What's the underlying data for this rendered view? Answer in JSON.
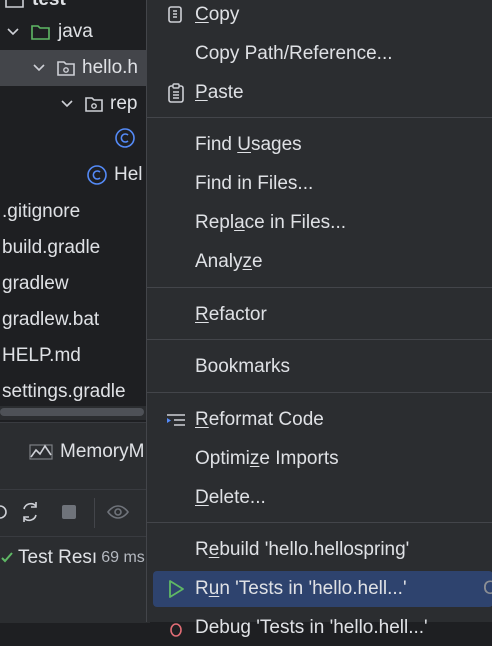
{
  "project_tree": {
    "items": [
      {
        "label": "test",
        "kind": "folder"
      },
      {
        "label": "java",
        "kind": "folder"
      },
      {
        "label": "hello.h",
        "kind": "package"
      },
      {
        "label": "rep",
        "kind": "package"
      },
      {
        "label": "",
        "kind": "class"
      },
      {
        "label": "Hel",
        "kind": "class"
      },
      {
        "label": ".gitignore",
        "kind": "file"
      },
      {
        "label": "build.gradle",
        "kind": "file"
      },
      {
        "label": "gradlew",
        "kind": "file"
      },
      {
        "label": "gradlew.bat",
        "kind": "file"
      },
      {
        "label": "HELP.md",
        "kind": "file"
      },
      {
        "label": "settings.gradle",
        "kind": "file"
      }
    ]
  },
  "bottom_panel": {
    "tab_label": "MemoryM",
    "test_status_label": "Test Resı",
    "test_time": "69 ms"
  },
  "context_menu": {
    "items": [
      {
        "pre": "",
        "u": "C",
        "post": "opy",
        "icon": "copy-icon"
      },
      {
        "pre": "Copy Path/Reference...",
        "u": "",
        "post": "",
        "icon": ""
      },
      {
        "pre": "",
        "u": "P",
        "post": "aste",
        "icon": "paste-icon"
      },
      {
        "pre": "Find ",
        "u": "U",
        "post": "sages",
        "icon": ""
      },
      {
        "pre": "Find in Files...",
        "u": "",
        "post": "",
        "icon": ""
      },
      {
        "pre": "Repl",
        "u": "a",
        "post": "ce in Files...",
        "icon": ""
      },
      {
        "pre": "Analy",
        "u": "z",
        "post": "e",
        "icon": ""
      },
      {
        "pre": "",
        "u": "R",
        "post": "efactor",
        "icon": ""
      },
      {
        "pre": "Bookmarks",
        "u": "",
        "post": "",
        "icon": ""
      },
      {
        "pre": "",
        "u": "R",
        "post": "eformat Code",
        "icon": "reformat-icon"
      },
      {
        "pre": "Optimi",
        "u": "z",
        "post": "e Imports",
        "icon": ""
      },
      {
        "pre": "",
        "u": "D",
        "post": "elete...",
        "icon": ""
      },
      {
        "pre": "R",
        "u": "e",
        "post": "build 'hello.hellospring'",
        "icon": ""
      },
      {
        "pre": "R",
        "u": "u",
        "post": "n 'Tests in 'hello.hell...'",
        "icon": "run-icon",
        "shortcut": "C",
        "highlighted": true
      },
      {
        "pre": "Debug 'Tests in 'hello.hell...'",
        "u": "",
        "post": "",
        "icon": "debug-icon"
      }
    ]
  },
  "colors": {
    "background": "#1e1f22",
    "panel": "#2b2d30",
    "highlight": "#2e436e",
    "text": "#dfe1e5",
    "class_icon": "#548af7",
    "run_icon": "#5fb865"
  }
}
